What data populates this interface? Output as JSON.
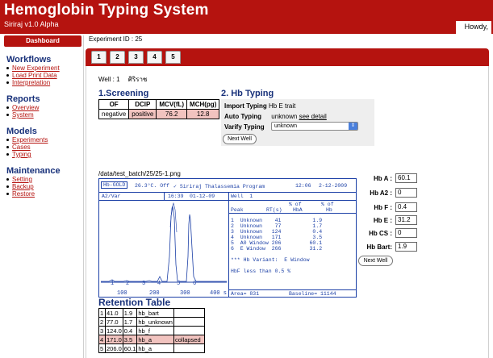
{
  "header": {
    "title": "Hemoglobin Typing System",
    "version": "Siriraj v1.0 Alpha",
    "greeting": "Howdy,"
  },
  "sidebar": {
    "dashboard_label": "Dashboard",
    "sections": [
      {
        "heading": "Workflows",
        "items": [
          "New Experiment",
          "Load Print Data",
          "Interpretation"
        ]
      },
      {
        "heading": "Reports",
        "items": [
          "Overview",
          "System"
        ]
      },
      {
        "heading": "Models",
        "items": [
          "Experiments",
          "Cases",
          "Typing"
        ]
      },
      {
        "heading": "Maintenance",
        "items": [
          "Setting",
          "Backup",
          "Restore"
        ]
      }
    ]
  },
  "main": {
    "experiment_id": "Experiment ID : 25",
    "tabs": [
      "1",
      "2",
      "3",
      "4",
      "5"
    ],
    "well_label": "Well : 1",
    "well_name": "ศิริราช",
    "screening": {
      "heading": "1.Screening",
      "headers": [
        "OF",
        "DCIP",
        "MCV(fL)",
        "MCH(pg)"
      ],
      "values": [
        "negative",
        "positive",
        "76.2",
        "12.8"
      ]
    },
    "typing": {
      "heading": "2. Hb Typing",
      "import_label": "Import Typing",
      "import_value": "Hb E trait",
      "auto_label": "Auto Typing",
      "auto_value": "unknown",
      "see_detail": "see detail",
      "varify_label": "Varify Typing",
      "varify_value": "unknown",
      "next_well": "Next Well"
    },
    "file_path": "/data/test_batch/25/25-1.png",
    "chromatogram": {
      "hbgold": "Hb-GOLD",
      "temp": "26.3°C. Off",
      "program": "✓ Siriraj Thalassemia Program",
      "time": "12:06",
      "date": "2-12-2009",
      "a2var": "A2/Var",
      "time2": "16:39",
      "date2": "01-12-09",
      "well": "Well  1",
      "col_pct1": "% of",
      "col_pct2": "% of",
      "col_peak": "Peak",
      "col_rt": "RT(s)",
      "col_hba": "HbA",
      "col_hb": "Hb",
      "peak_rows": [
        "1  Unknown    41          1.9",
        "2  Unknown    77          1.7",
        "3  Unknown   124          0.4",
        "4  Unknown   171          3.5",
        "5  A0 Window 206         60.1",
        "6  E Window  266         31.2"
      ],
      "variant": "*** Hb Variant:  E Window",
      "hbf_note": "HbF less than 0.5 %",
      "peak_nums": [
        "1",
        "2",
        "3",
        "4",
        "5",
        "6"
      ],
      "x_ticks": [
        "100",
        "200",
        "300",
        "400 s"
      ],
      "area": "Area= 831",
      "baseline": "Baseline= 11144"
    },
    "hb_values": [
      {
        "label": "Hb A :",
        "value": "60.1"
      },
      {
        "label": "Hb A2 :",
        "value": "0"
      },
      {
        "label": "Hb F :",
        "value": "0.4"
      },
      {
        "label": "Hb E :",
        "value": "31.2"
      },
      {
        "label": "Hb CS :",
        "value": "0"
      },
      {
        "label": "Hb Bart:",
        "value": "1.9"
      }
    ],
    "next_well_2": "Next Well",
    "retention": {
      "heading": "Retention Table",
      "rows": [
        [
          "1",
          "41.0",
          "1.9",
          "hb_bart",
          ""
        ],
        [
          "2",
          "77.0",
          "1.7",
          "hb_unknown",
          ""
        ],
        [
          "3",
          "124.0",
          "0.4",
          "hb_f",
          ""
        ],
        [
          "4",
          "171.0",
          "3.5",
          "hb_a",
          "collapsed"
        ],
        [
          "5",
          "206.0",
          "60.1",
          "hb_a",
          ""
        ]
      ]
    }
  }
}
